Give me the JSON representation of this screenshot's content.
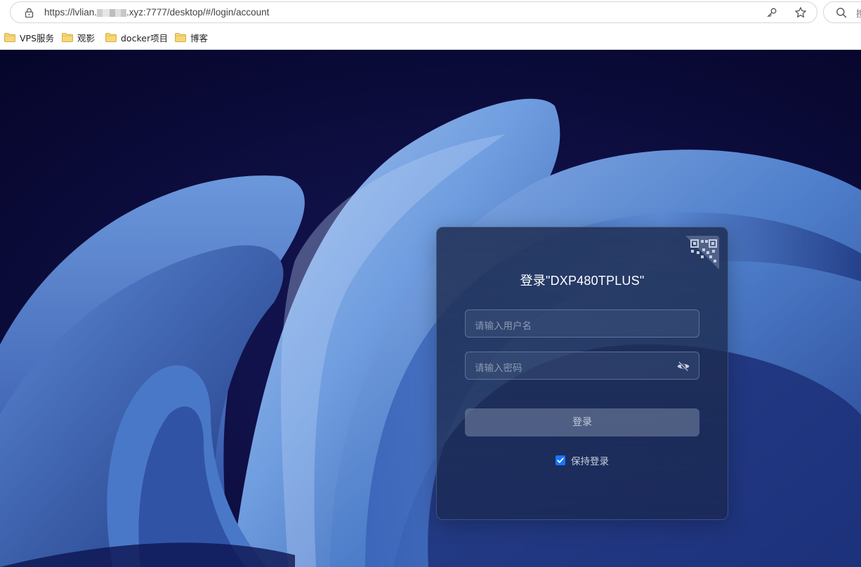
{
  "browser": {
    "url_prefix": "https://lvlian.",
    "url_suffix": ".xyz:7777/desktop/#/login/account",
    "search_hint": "搜"
  },
  "bookmarks": [
    {
      "label": "VPS服务",
      "icon": "folder-icon"
    },
    {
      "label": "观影",
      "icon": "folder-icon"
    },
    {
      "label": "docker项目",
      "icon": "folder-icon"
    },
    {
      "label": "博客",
      "icon": "folder-icon"
    }
  ],
  "login": {
    "title": "登录\"DXP480TPLUS\"",
    "username_placeholder": "请输入用户名",
    "password_placeholder": "请输入密码",
    "submit_label": "登录",
    "remember_label": "保持登录",
    "remember_checked": true
  },
  "colors": {
    "accent": "#1677ff",
    "page_background": "#07072c",
    "wallpaper_blue": "#5a8fd6"
  }
}
